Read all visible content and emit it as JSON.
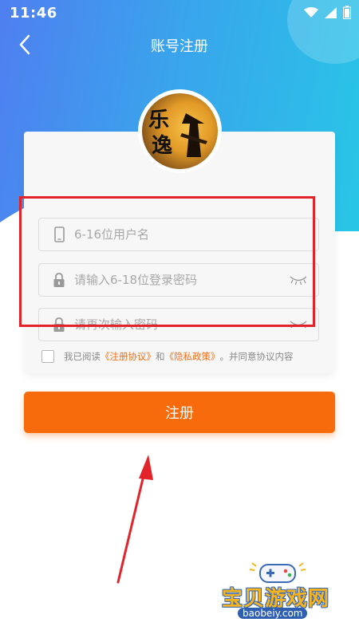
{
  "status": {
    "time": "11:46",
    "icons": [
      "wifi-icon",
      "signal-icon",
      "battery-icon"
    ]
  },
  "nav": {
    "title": "账号注册",
    "back_icon": "chevron-left-icon"
  },
  "avatar": {
    "logo_text": "乐逸"
  },
  "form": {
    "username_placeholder": "6-16位用户名",
    "password_placeholder": "请输入6-18位登录密码",
    "confirm_placeholder": "请再次输入密码"
  },
  "agreement": {
    "prefix": "我已阅读",
    "terms": "《注册协议》",
    "and": "和",
    "privacy": "《隐私政策》",
    "suffix": "。并同意协议内容"
  },
  "register_button": "注册",
  "watermark": {
    "name": "宝贝游戏网",
    "url": "baobeiy.com"
  },
  "colors": {
    "accent": "#f76b0c",
    "hero_start": "#4f7ff0",
    "hero_end": "#28c6e6",
    "highlight": "#e3232a",
    "link": "#f2701d"
  }
}
